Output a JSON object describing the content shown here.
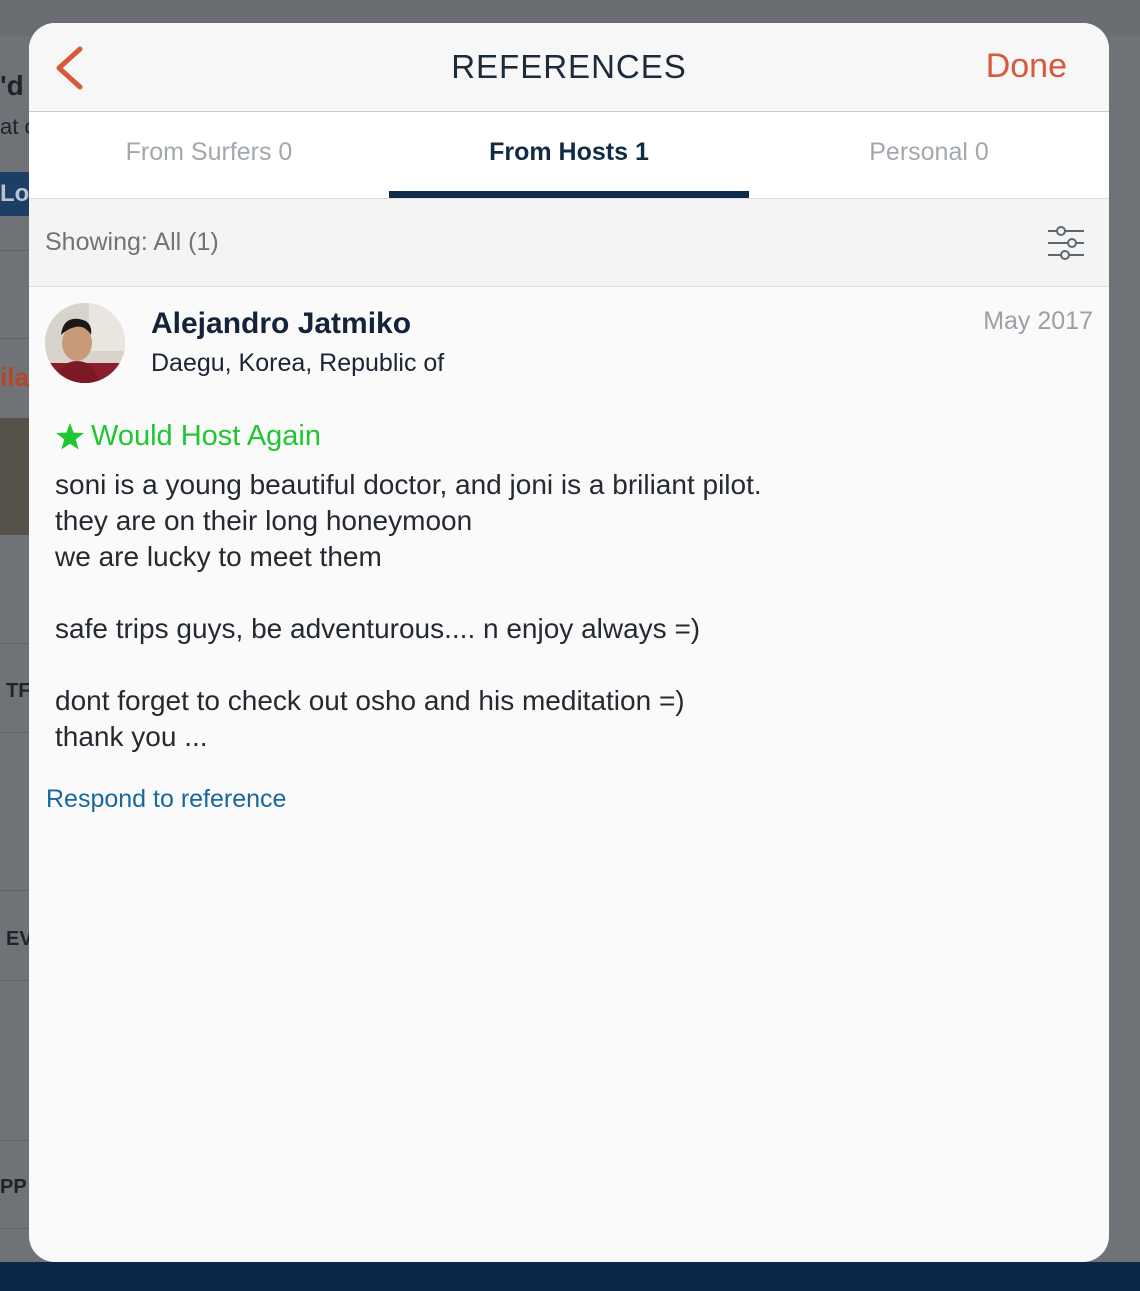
{
  "background": {
    "fragments": [
      "'d l",
      "at c",
      "Lov",
      "ila",
      "TF",
      "EV",
      "PP"
    ]
  },
  "navbar": {
    "title": "REFERENCES",
    "back_icon": "chevron-left-icon",
    "done_label": "Done"
  },
  "tabs": [
    {
      "label": "From Surfers 0",
      "active": false
    },
    {
      "label": "From Hosts 1",
      "active": true
    },
    {
      "label": "Personal 0",
      "active": false
    }
  ],
  "filter": {
    "showing_label": "Showing: All (1)",
    "icon": "sliders-icon"
  },
  "reference": {
    "author_name": "Alejandro Jatmiko",
    "author_location": "Daegu, Korea, Republic of",
    "date": "May 2017",
    "badge_label": "Would Host Again",
    "badge_icon": "star-icon",
    "body": "soni is a young beautiful doctor, and joni is a briliant pilot.\nthey are on their long honeymoon\nwe are lucky to meet them\n\nsafe trips guys, be adventurous.... n enjoy always =)\n\ndont forget to check out osho and his meditation =)\nthank you ...",
    "respond_label": "Respond to reference"
  },
  "colors": {
    "accent_orange": "#d9573a",
    "navy": "#0f2c4a",
    "positive_green": "#1ec732",
    "link_blue": "#18679d"
  }
}
